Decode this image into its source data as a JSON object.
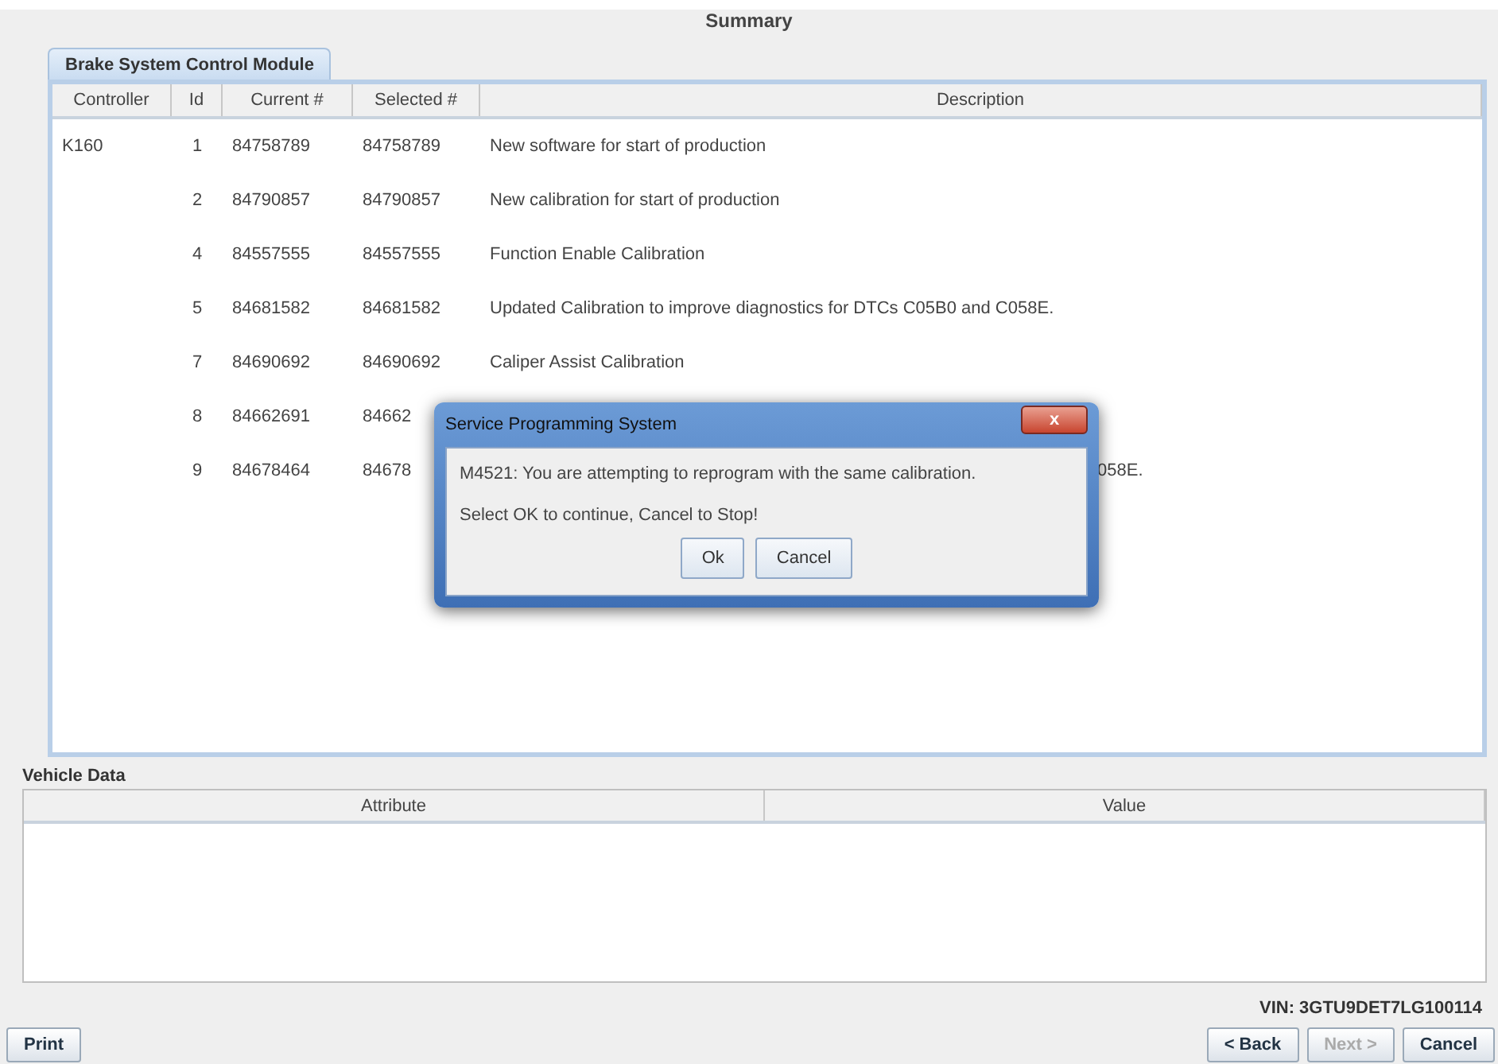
{
  "title": "Summary",
  "tabs": [
    {
      "label": "Brake System Control Module",
      "selected": true
    }
  ],
  "table": {
    "columns": [
      "Controller",
      "Id",
      "Current #",
      "Selected #",
      "Description"
    ],
    "rows": [
      {
        "controller": "K160",
        "id": "1",
        "current": "84758789",
        "selected_no": "84758789",
        "description": "New software for start of production"
      },
      {
        "id": "2",
        "current": "84790857",
        "selected_no": "84790857",
        "description": "New calibration for start of production"
      },
      {
        "id": "4",
        "current": "84557555",
        "selected_no": "84557555",
        "description": "Function Enable Calibration"
      },
      {
        "id": "5",
        "current": "84681582",
        "selected_no": "84681582",
        "description": "Updated Calibration to improve diagnostics for DTCs C05B0 and C058E."
      },
      {
        "id": "7",
        "current": "84690692",
        "selected_no": "84690692",
        "description": "Caliper Assist Calibration"
      },
      {
        "id": "8",
        "current": "84662691",
        "selected_no": "84662"
      },
      {
        "id": "9",
        "current": "84678464",
        "selected_no": "84678",
        "description_tail": "058E."
      }
    ]
  },
  "vehicle_data": {
    "label": "Vehicle Data",
    "columns": [
      "Attribute",
      "Value"
    ]
  },
  "vin": "VIN: 3GTU9DET7LG100114",
  "buttons": [
    {
      "label": "Print",
      "disabled": false
    },
    {
      "label": "< Back",
      "disabled": false
    },
    {
      "label": "Next >",
      "disabled": true
    },
    {
      "label": "Cancel",
      "disabled": false
    }
  ],
  "dialog": {
    "title": "Service Programming System",
    "close": "x",
    "message": "M4521: You are attempting to reprogram with the same calibration.",
    "prompt": "Select OK to continue, Cancel to Stop!",
    "buttons": [
      "Ok",
      "Cancel"
    ]
  }
}
